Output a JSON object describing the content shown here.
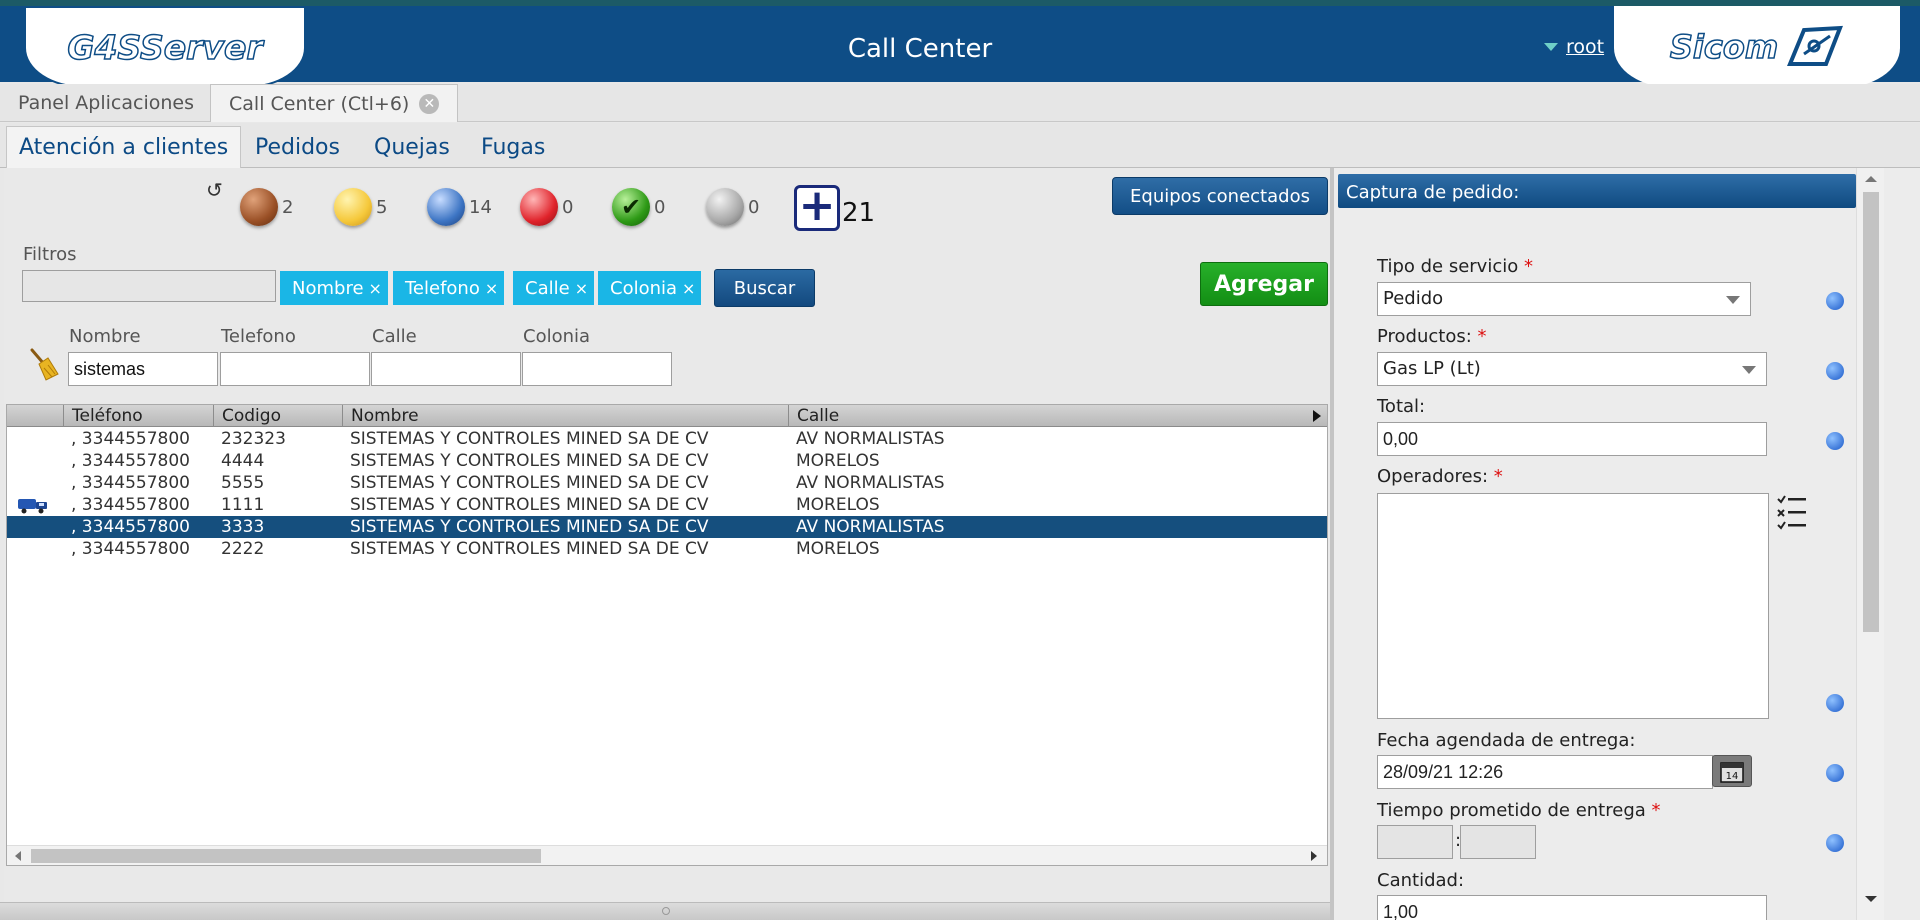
{
  "header": {
    "logo_left": "G4SServer",
    "title": "Call Center",
    "user": "root",
    "logo_right": "Sicom"
  },
  "app_tabs": [
    {
      "label": "Panel Aplicaciones"
    },
    {
      "label": "Call Center (Ctl+6)"
    }
  ],
  "sub_tabs": [
    {
      "label": "Atención a clientes"
    },
    {
      "label": "Pedidos"
    },
    {
      "label": "Quejas"
    },
    {
      "label": "Fugas"
    }
  ],
  "status_counts": [
    {
      "color": "#9a5026",
      "count": "2"
    },
    {
      "color": "#f5c83a",
      "count": "5"
    },
    {
      "color": "#3d75c4",
      "count": "14"
    },
    {
      "color": "#e0232b",
      "count": "0"
    },
    {
      "color": "#2e9a16",
      "count": "0"
    },
    {
      "color": "#a9a9a9",
      "count": "0"
    }
  ],
  "plus_count": "21",
  "buttons": {
    "equipos": "Equipos conectados",
    "buscar": "Buscar",
    "agregar": "Agregar"
  },
  "filters": {
    "label": "Filtros",
    "input_value": "",
    "chips": [
      "Nombre",
      "Telefono",
      "Calle",
      "Colonia"
    ]
  },
  "search_fields": {
    "nombre": {
      "label": "Nombre",
      "value": "sistemas"
    },
    "telefono": {
      "label": "Telefono",
      "value": ""
    },
    "calle": {
      "label": "Calle",
      "value": ""
    },
    "colonia": {
      "label": "Colonia",
      "value": ""
    }
  },
  "grid": {
    "columns": [
      "Teléfono",
      "Codigo",
      "Nombre",
      "Calle"
    ],
    "rows": [
      {
        "telefono": ", 3344557800",
        "codigo": "232323",
        "nombre": "SISTEMAS Y CONTROLES MINED SA DE CV",
        "calle": "AV NORMALISTAS"
      },
      {
        "telefono": ", 3344557800",
        "codigo": "4444",
        "nombre": "SISTEMAS Y CONTROLES MINED SA DE CV",
        "calle": "MORELOS"
      },
      {
        "telefono": ", 3344557800",
        "codigo": "5555",
        "nombre": "SISTEMAS Y CONTROLES MINED SA DE CV",
        "calle": "AV NORMALISTAS"
      },
      {
        "telefono": ", 3344557800",
        "codigo": "1111",
        "nombre": "SISTEMAS Y CONTROLES MINED SA DE CV",
        "calle": "MORELOS",
        "icon": "truck-icon"
      },
      {
        "telefono": ", 3344557800",
        "codigo": "3333",
        "nombre": "SISTEMAS Y CONTROLES MINED SA DE CV",
        "calle": "AV NORMALISTAS",
        "selected": true
      },
      {
        "telefono": ", 3344557800",
        "codigo": "2222",
        "nombre": "SISTEMAS Y CONTROLES MINED SA DE CV",
        "calle": "MORELOS"
      }
    ]
  },
  "order_form": {
    "title": "Captura de pedido:",
    "tipo_servicio": {
      "label": "Tipo de servicio",
      "value": "Pedido"
    },
    "productos": {
      "label": "Productos:",
      "value": "Gas LP (Lt)"
    },
    "total": {
      "label": "Total:",
      "value": "0,00"
    },
    "operadores": {
      "label": "Operadores:"
    },
    "fecha": {
      "label": "Fecha agendada de entrega:",
      "value": "28/09/21 12:26",
      "calendar_day": "14"
    },
    "tiempo": {
      "label": "Tiempo prometido de entrega",
      "hours": "",
      "minutes": ""
    },
    "cantidad": {
      "label": "Cantidad:",
      "value": "1,00"
    }
  }
}
